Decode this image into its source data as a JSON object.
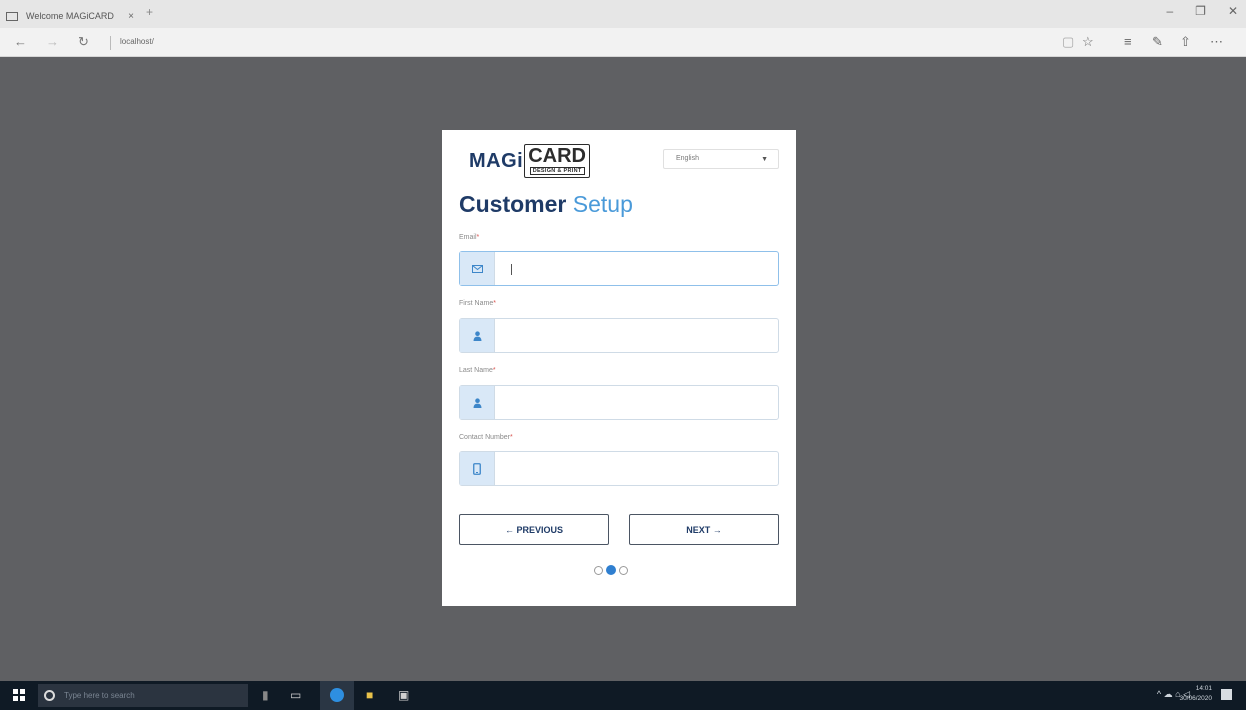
{
  "browser": {
    "tab_title": "Welcome MAGiCARD",
    "tab_close": "×",
    "new_tab": "+",
    "window_controls": [
      "–",
      "❐",
      "✕"
    ],
    "address": "localhost/",
    "nav_icons": [
      "back-arrow-icon",
      "forward-arrow-icon",
      "refresh-icon"
    ],
    "toolbar_icons": [
      "reading-view-icon",
      "favorite-star-icon",
      "hub-icon",
      "web-note-icon",
      "share-icon",
      "more-icon"
    ]
  },
  "card": {
    "logo": {
      "magi": "MAGi",
      "card": "CARD",
      "sub": "DESIGN & PRINT"
    },
    "language": {
      "selected": "English"
    },
    "heading": {
      "part1": "Customer",
      "part2": "Setup"
    },
    "fields": [
      {
        "label": "Email",
        "required": "*",
        "icon": "envelope-icon",
        "value": ""
      },
      {
        "label": "First Name",
        "required": "*",
        "icon": "user-icon",
        "value": ""
      },
      {
        "label": "Last Name",
        "required": "*",
        "icon": "user-icon",
        "value": ""
      },
      {
        "label": "Contact Number",
        "required": "*",
        "icon": "mobile-phone-icon",
        "value": ""
      }
    ],
    "buttons": {
      "previous": "← PREVIOUS",
      "next": "NEXT →"
    },
    "steps": {
      "total": 3,
      "current": 2
    }
  },
  "taskbar": {
    "search_placeholder": "Type here to search",
    "clock": {
      "time": "14:01",
      "date": "30/06/2020"
    }
  },
  "colors": {
    "backdrop": "#5f6063",
    "brand_navy": "#1f3b67",
    "accent_blue": "#4a9ad9",
    "addon_bg": "#d9e8f7",
    "required": "#d9534f",
    "taskbar": "#0f1a25"
  }
}
